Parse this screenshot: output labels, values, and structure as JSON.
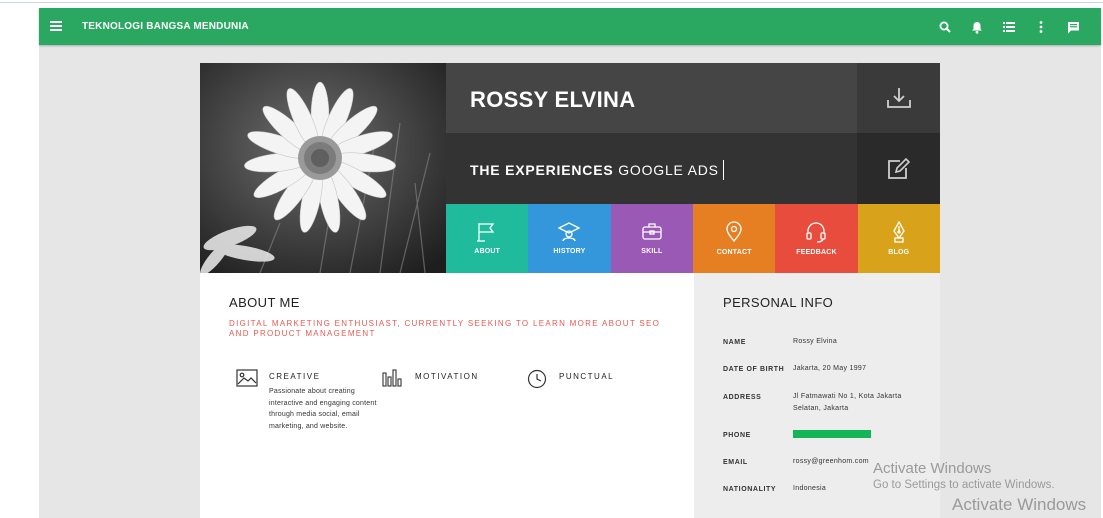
{
  "appbar": {
    "title": "TEKNOLOGI BANGSA MENDUNIA",
    "background": "#2aa862",
    "icons": [
      "search-icon",
      "notifications-icon",
      "list-icon",
      "more-vert-icon",
      "chat-icon"
    ]
  },
  "hero": {
    "name": "ROSSY ELVINA",
    "experience_prefix": "THE EXPERIENCES",
    "experience_value": "GOOGLE ADS",
    "photo_icon": "daisy-flower-photo",
    "download_icon": "download-icon",
    "edit_icon": "edit-icon"
  },
  "tiles": [
    {
      "label": "ABOUT",
      "color": "#1fbb9c",
      "icon": "flag-icon"
    },
    {
      "label": "HISTORY",
      "color": "#3597db",
      "icon": "graduation-icon"
    },
    {
      "label": "SKILL",
      "color": "#9b59b6",
      "icon": "briefcase-icon"
    },
    {
      "label": "CONTACT",
      "color": "#e67e22",
      "icon": "location-pin-icon"
    },
    {
      "label": "FEEDBACK",
      "color": "#e74c3c",
      "icon": "headset-icon"
    },
    {
      "label": "BLOG",
      "color": "#d8a31a",
      "icon": "pen-nib-icon"
    }
  ],
  "about": {
    "title": "ABOUT ME",
    "tagline": "DIGITAL MARKETING ENTHUSIAST, CURRENTLY SEEKING TO LEARN MORE ABOUT SEO AND PRODUCT MANAGEMENT",
    "tagline_color": "#e85a4f",
    "traits": [
      {
        "name": "CREATIVE",
        "icon": "image-icon",
        "desc": "Passionate about creating interactive and engaging content through media social, email marketing, and website."
      },
      {
        "name": "MOTIVATION",
        "icon": "bar-chart-icon",
        "desc": ""
      },
      {
        "name": "PUNCTUAL",
        "icon": "clock-icon",
        "desc": ""
      }
    ]
  },
  "personal_info": {
    "title": "PERSONAL INFO",
    "rows": [
      {
        "key": "NAME",
        "value": "Rossy Elvina"
      },
      {
        "key": "DATE OF BIRTH",
        "value": "Jakarta, 20 May 1997"
      },
      {
        "key": "ADDRESS",
        "value": "Jl Fatmawati No 1, Kota Jakarta Selatan, Jakarta"
      },
      {
        "key": "PHONE",
        "value": ""
      },
      {
        "key": "EMAIL",
        "value": "rossy@greenhom.com"
      },
      {
        "key": "NATIONALITY",
        "value": "Indonesia"
      }
    ],
    "phone_redaction_color": "#13b556"
  },
  "watermark": {
    "line1": "Activate Windows",
    "line2": "Go to Settings to activate Windows.",
    "line3": "Activate Windows"
  }
}
